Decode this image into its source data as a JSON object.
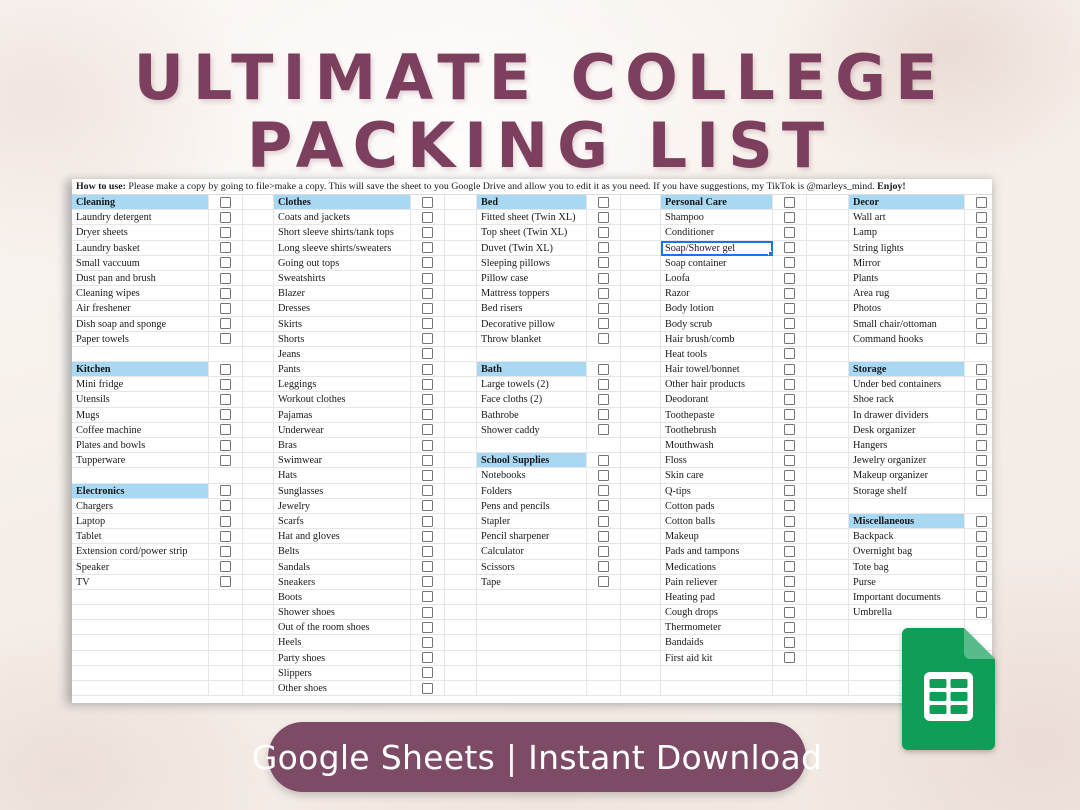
{
  "title": {
    "line1": "Ultimate College",
    "line2": "Packing List"
  },
  "cta": {
    "label": "Google Sheets | Instant Download",
    "bg": "#7d4b66",
    "text_color": "#ffffff"
  },
  "icon": {
    "name": "google-sheets-icon",
    "color": "#0f9d58",
    "fold_color": "#57bb8a"
  },
  "colors": {
    "title": "#7d3f5e",
    "section_header_bg": "#a9d8f2",
    "grid_line": "#e4e6e8",
    "selection": "#1a73e8"
  },
  "sheet": {
    "howto_prefix": "How to use:",
    "howto_body": " Please make a copy by going to file>make a copy. This will save the sheet to you Google Drive and allow you to edit it as you need. If you have suggestions, my TikTok is @marleys_mind. ",
    "howto_suffix": "Enjoy!",
    "selected_cell": "Soap/Shower gel",
    "columns": [
      {
        "id": "col-1",
        "sections": [
          {
            "header": "Cleaning",
            "items": [
              "Laundry detergent",
              "Dryer sheets",
              "Laundry basket",
              "Small vaccuum",
              "Dust pan and brush",
              "Cleaning wipes",
              "Air freshener",
              "Dish soap and sponge",
              "Paper towels"
            ]
          },
          {
            "header": "Kitchen",
            "items": [
              "Mini fridge",
              "Utensils",
              "Mugs",
              "Coffee machine",
              "Plates and bowls",
              "Tupperware"
            ]
          },
          {
            "header": "Electronics",
            "items": [
              "Chargers",
              "Laptop",
              "Tablet",
              "Extension cord/power strip",
              "Speaker",
              "TV"
            ]
          }
        ]
      },
      {
        "id": "col-2",
        "sections": [
          {
            "header": "Clothes",
            "items": [
              "Coats and jackets",
              "Short sleeve shirts/tank tops",
              "Long sleeve shirts/sweaters",
              "Going out tops",
              "Sweatshirts",
              "Blazer",
              "Dresses",
              "Skirts",
              "Shorts",
              "Jeans",
              "Pants",
              "Leggings",
              "Workout clothes",
              "Pajamas",
              "Underwear",
              "Bras",
              "Swimwear",
              "Hats",
              "Sunglasses",
              "Jewelry",
              "Scarfs",
              "Hat and gloves",
              "Belts",
              "Sandals",
              "Sneakers",
              "Boots",
              "Shower shoes",
              "Out of the room shoes",
              "Heels",
              "Party shoes",
              "Slippers",
              "Other shoes"
            ]
          }
        ]
      },
      {
        "id": "col-3",
        "sections": [
          {
            "header": "Bed",
            "items": [
              "Fitted sheet (Twin XL)",
              "Top sheet (Twin XL)",
              "Duvet (Twin XL)",
              "Sleeping pillows",
              "Pillow case",
              "Mattress toppers",
              "Bed risers",
              "Decorative pillow",
              "Throw blanket"
            ]
          },
          {
            "header": "Bath",
            "items": [
              "Large towels (2)",
              "Face cloths (2)",
              "Bathrobe",
              "Shower caddy"
            ]
          },
          {
            "header": "School Supplies",
            "items": [
              "Notebooks",
              "Folders",
              "Pens and pencils",
              "Stapler",
              "Pencil sharpener",
              "Calculator",
              "Scissors",
              "Tape"
            ]
          }
        ]
      },
      {
        "id": "col-4",
        "sections": [
          {
            "header": "Personal Care",
            "items": [
              "Shampoo",
              "Conditioner",
              "Soap/Shower gel",
              "Soap container",
              "Loofa",
              "Razor",
              "Body lotion",
              "Body scrub",
              "Hair brush/comb",
              "Heat tools",
              "Hair towel/bonnet",
              "Other hair products",
              "Deodorant",
              "Toothepaste",
              "Toothebrush",
              "Mouthwash",
              "Floss",
              "Skin care",
              "Q-tips",
              "Cotton pads",
              "Cotton balls",
              "Makeup",
              "Pads and tampons",
              "Medications",
              "Pain reliever",
              "Heating pad",
              "Cough drops",
              "Thermometer",
              "Bandaids",
              "First aid kit"
            ]
          }
        ]
      },
      {
        "id": "col-5",
        "sections": [
          {
            "header": "Decor",
            "items": [
              "Wall art",
              "Lamp",
              "String lights",
              "Mirror",
              "Plants",
              "Area rug",
              "Photos",
              "Small chair/ottoman",
              "Command hooks"
            ]
          },
          {
            "header": "Storage",
            "items": [
              "Under bed containers",
              "Shoe rack",
              "In drawer dividers",
              "Desk organizer",
              "Hangers",
              "Jewelry organizer",
              "Makeup organizer",
              "Storage shelf"
            ]
          },
          {
            "header": "Miscellaneous",
            "items": [
              "Backpack",
              "Overnight bag",
              "Tote bag",
              "Purse",
              "Important documents",
              "Umbrella"
            ]
          }
        ]
      }
    ]
  }
}
